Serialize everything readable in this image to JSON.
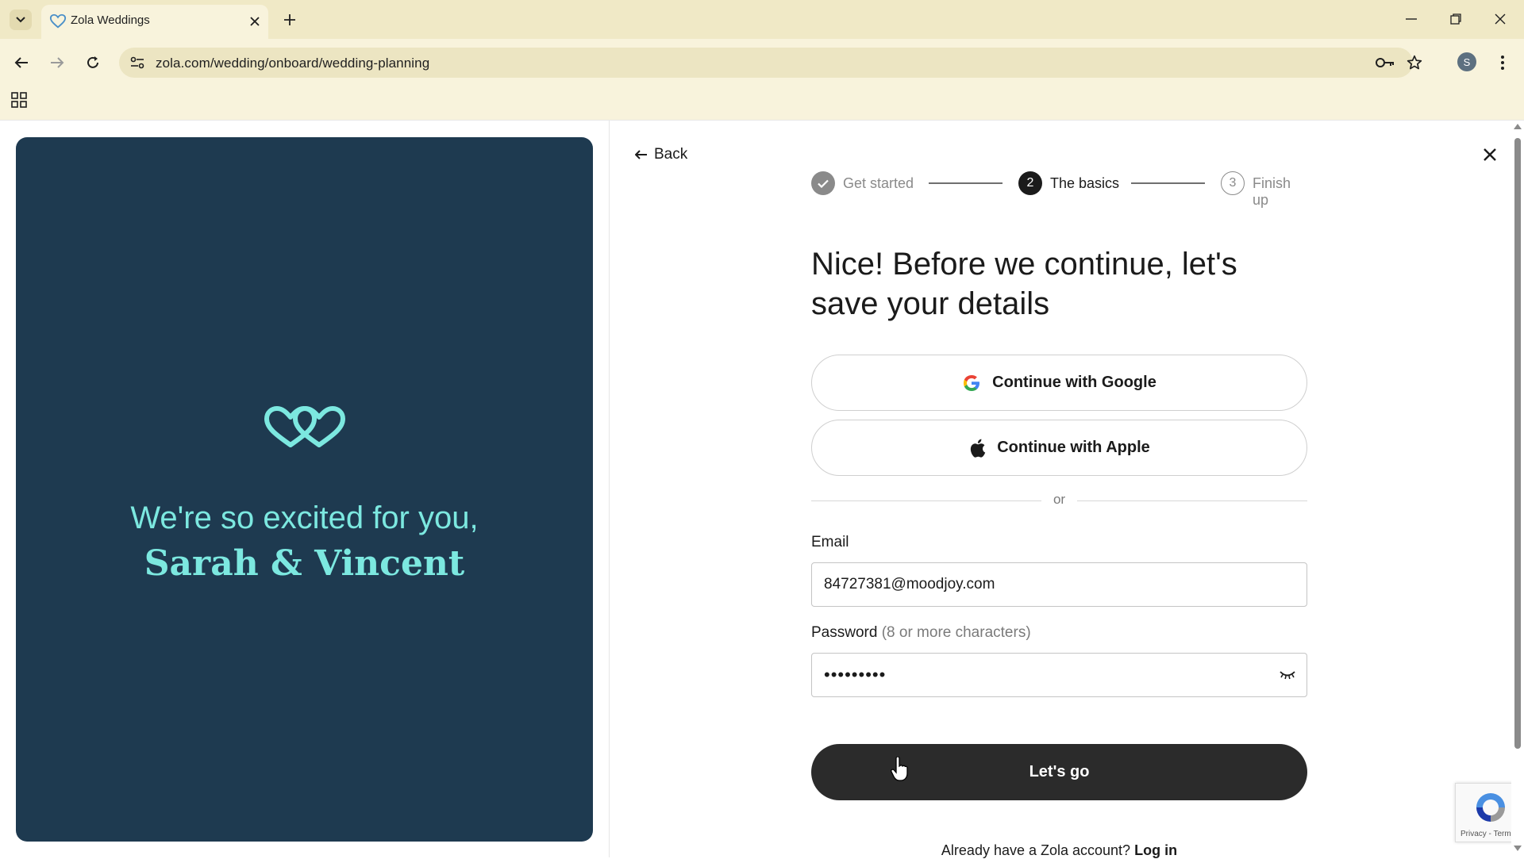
{
  "browser": {
    "tab_title": "Zola Weddings",
    "url": "zola.com/wedding/onboard/wedding-planning",
    "profile_initial": "S",
    "icons": [
      "tab-list-icon",
      "heart-favicon-icon",
      "close-tab-icon",
      "new-tab-icon",
      "minimize-icon",
      "restore-icon",
      "close-window-icon",
      "back-arrow-icon",
      "forward-arrow-icon",
      "reload-icon",
      "site-info-icon",
      "key-icon",
      "star-icon",
      "menu-dots-icon",
      "apps-icon"
    ]
  },
  "hero": {
    "line1": "We're so excited for you,",
    "line2": "Sarah & Vincent",
    "accent_color": "#7ce8e0",
    "background_color": "#1e3a50"
  },
  "nav": {
    "back_label": "Back"
  },
  "stepper": {
    "steps": [
      {
        "number": "",
        "label": "Get started",
        "state": "completed"
      },
      {
        "number": "2",
        "label": "The basics",
        "state": "current"
      },
      {
        "number": "3",
        "label": "Finish up",
        "state": "upcoming"
      }
    ]
  },
  "form": {
    "heading": "Nice! Before we continue, let's save your details",
    "google_label": "Continue with Google",
    "apple_label": "Continue with Apple",
    "or_label": "or",
    "email_label": "Email",
    "email_value": "84727381@moodjoy.com",
    "password_label": "Password",
    "password_hint": "(8 or more characters)",
    "password_value": "•••••••••",
    "submit_label": "Let's go",
    "login_prompt": "Already have a Zola account?",
    "login_link": "Log in"
  },
  "recaptcha": {
    "footer": "Privacy - Terms"
  }
}
